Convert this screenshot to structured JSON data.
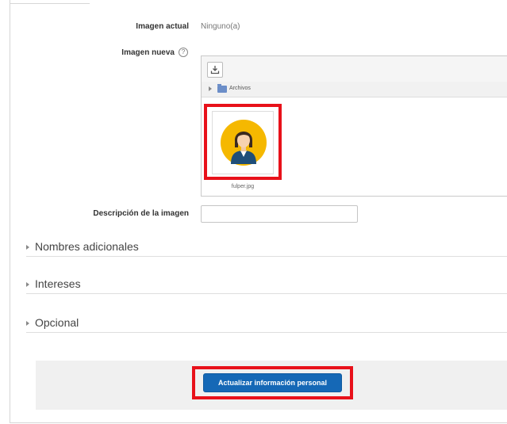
{
  "current_image": {
    "label": "Imagen actual",
    "value": "Ninguno(a)"
  },
  "new_image": {
    "label": "Imagen nueva",
    "help_icon": "question-circle-icon",
    "filepicker": {
      "upload_icon": "download-tray-icon",
      "path_label": "Archivos",
      "file_name": "fulper.jpg"
    }
  },
  "image_description": {
    "label": "Descripción de la imagen",
    "value": ""
  },
  "sections": [
    {
      "title": "Nombres adicionales"
    },
    {
      "title": "Intereses"
    },
    {
      "title": "Opcional"
    }
  ],
  "footer": {
    "submit_label": "Actualizar información personal"
  },
  "colors": {
    "highlight": "#e8111a",
    "button": "#1568b6",
    "folder": "#6c8ec8",
    "avatar_bg": "#f5b800"
  }
}
